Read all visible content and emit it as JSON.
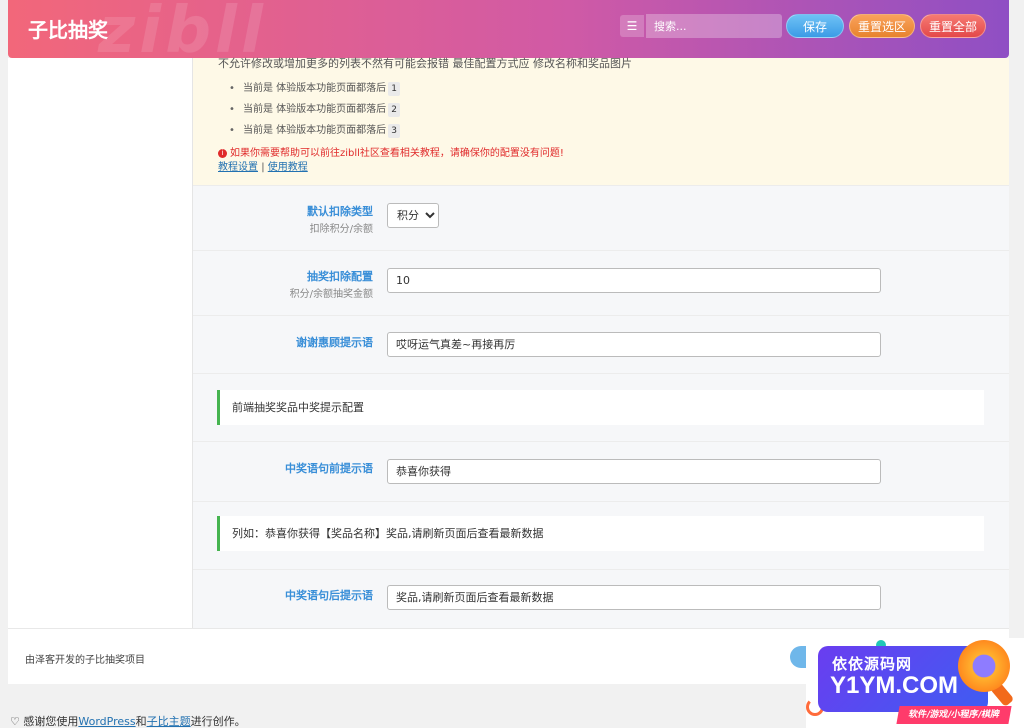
{
  "header": {
    "title": "子比抽奖",
    "watermark": "zibll",
    "search_placeholder": "搜索...",
    "save_label": "保存",
    "reset_section_label": "重置选区",
    "reset_all_label": "重置全部"
  },
  "notice": {
    "top_text": "不允许修改或增加更多的列表不然有可能会报错 最佳配置方式应 修改名称和奖品图片",
    "items": [
      {
        "text": "当前是 体验版本功能页面都落后",
        "num": "1"
      },
      {
        "text": "当前是 体验版本功能页面都落后",
        "num": "2"
      },
      {
        "text": "当前是 体验版本功能页面都落后",
        "num": "3"
      }
    ],
    "warning": "如果你需要帮助可以前往zibll社区查看相关教程，请确保你的配置没有问题!",
    "link1": "教程设置",
    "separator": "|",
    "link2": "使用教程"
  },
  "fields": {
    "deduct_type": {
      "label": "默认扣除类型",
      "sub": "扣除积分/余额",
      "value": "积分"
    },
    "deduct_amount": {
      "label": "抽奖扣除配置",
      "sub": "积分/余额抽奖金额",
      "value": "10"
    },
    "thanks_msg": {
      "label": "谢谢惠顾提示语",
      "value": "哎呀运气真差~再接再厉"
    },
    "prefix_msg": {
      "label": "中奖语句前提示语",
      "value": "恭喜你获得"
    },
    "suffix_msg": {
      "label": "中奖语句后提示语",
      "value": "奖品,请刷新页面后查看最新数据"
    }
  },
  "callouts": {
    "section_title": "前端抽奖奖品中奖提示配置",
    "example": "列如：恭喜你获得【奖品名称】奖品,请刷新页面后查看最新数据"
  },
  "footer": {
    "text": "由泽客开发的子比抽奖项目",
    "credit_prefix": "♡ 感谢您使用",
    "credit_wp": "WordPress",
    "credit_and": "和",
    "credit_theme": "子比主题",
    "credit_suffix": "进行创作。"
  },
  "ad": {
    "line1": "依依源码网",
    "line2": "Y1YM.COM",
    "tag": "软件/游戏/小程序/棋牌"
  },
  "colors": {
    "accent": "#3a8fd8",
    "success_border": "#46b450",
    "warning": "#e02b2b",
    "header_start": "#f2677a",
    "header_end": "#8f4fc4"
  }
}
